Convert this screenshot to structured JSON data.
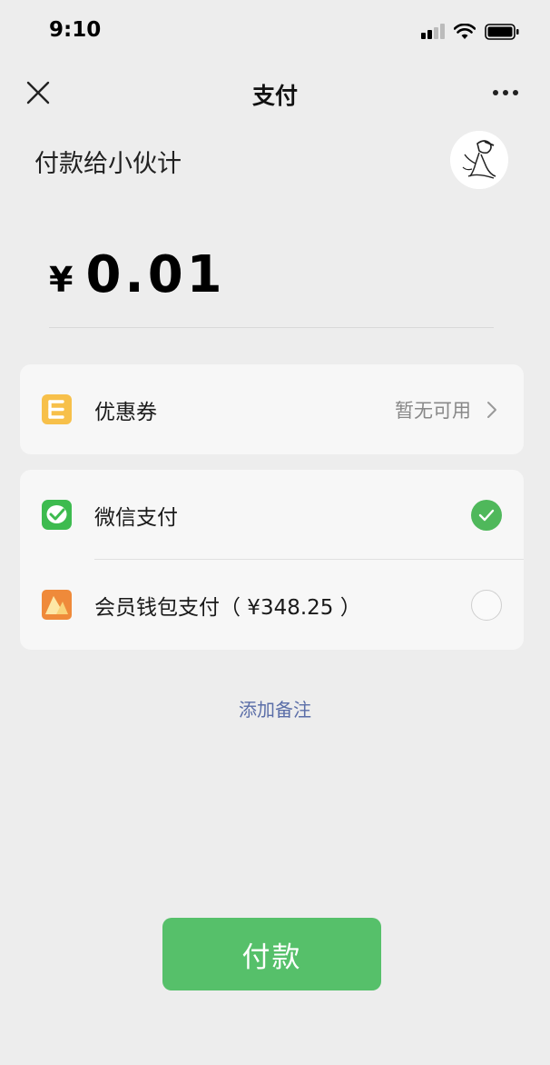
{
  "status_bar": {
    "time": "9:10"
  },
  "nav": {
    "title": "支付"
  },
  "payee": {
    "label": "付款给小伙计"
  },
  "amount": {
    "currency": "¥",
    "value": "0.01"
  },
  "coupon": {
    "label": "优惠券",
    "status": "暂无可用"
  },
  "payment_methods": [
    {
      "label": "微信支付",
      "selected": true
    },
    {
      "label": "会员钱包支付（ ¥348.25 ）",
      "selected": false
    }
  ],
  "add_note": {
    "label": "添加备注"
  },
  "pay_button": {
    "label": "付款"
  },
  "colors": {
    "accent_green": "#56c06a",
    "check_green": "#4fb85b",
    "link_blue": "#5b6ea8",
    "background": "#ededed"
  },
  "icons": [
    "signal-icon",
    "wifi-icon",
    "battery-icon",
    "close-icon",
    "more-icon",
    "avatar",
    "coupon-icon",
    "wechat-pay-icon",
    "wallet-icon",
    "chevron-right-icon",
    "check-icon"
  ]
}
